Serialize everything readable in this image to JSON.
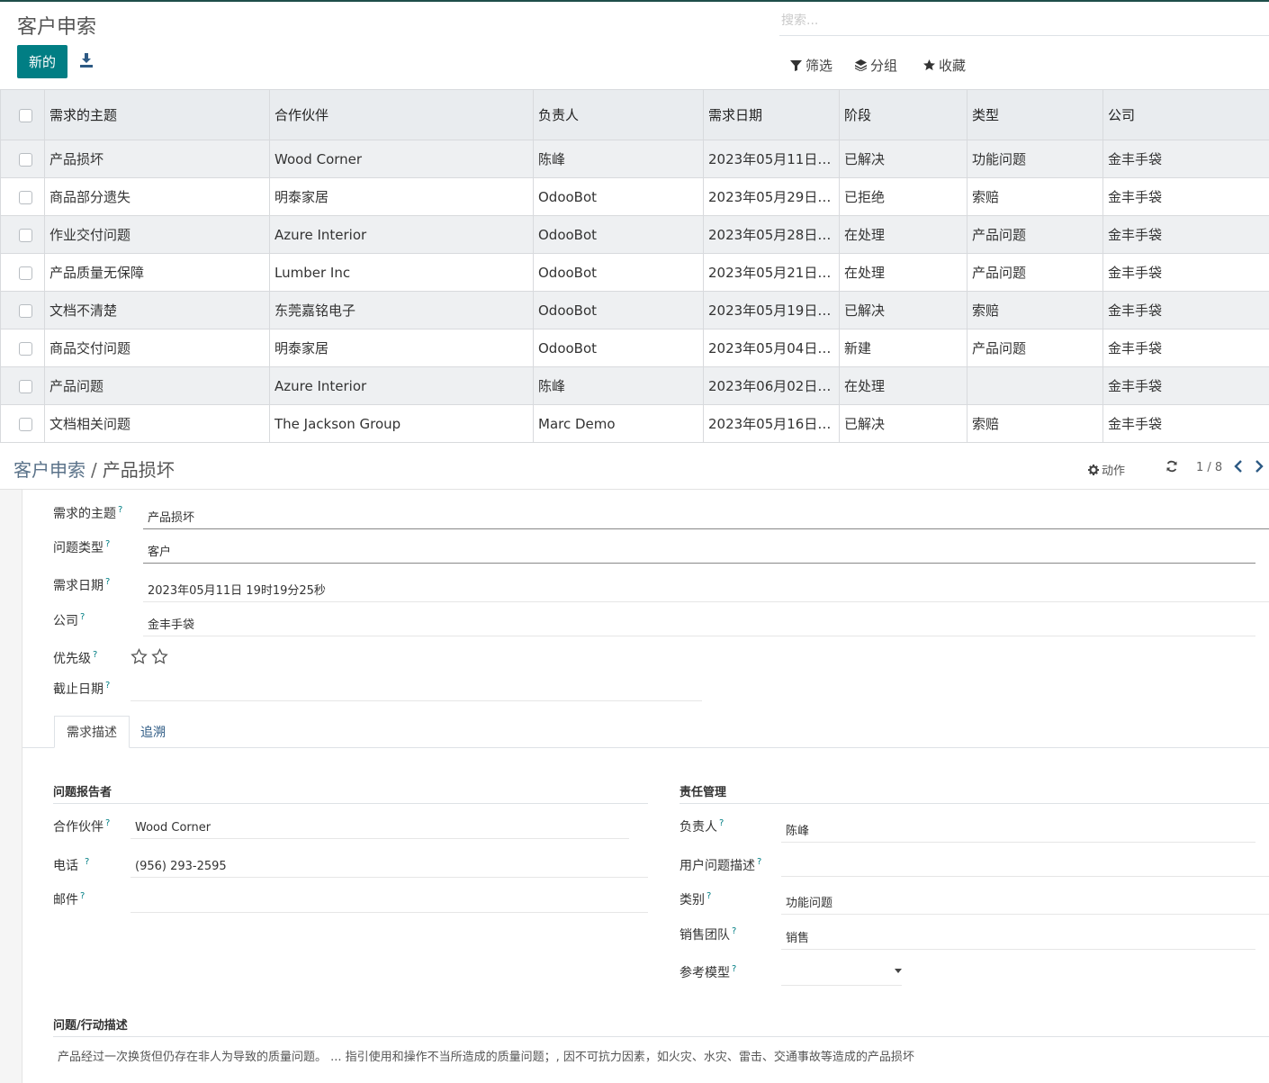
{
  "app": {
    "title": "客户申索",
    "new_label": "新的",
    "search_placeholder": "搜索...",
    "filter_label": "筛选",
    "group_label": "分组",
    "favorite_label": "收藏"
  },
  "table": {
    "columns": [
      "需求的主题",
      "合作伙伴",
      "负责人",
      "需求日期",
      "阶段",
      "类型",
      "公司"
    ],
    "rows": [
      [
        "产品损坏",
        "Wood Corner",
        "陈峰",
        "2023年05月11日 ...",
        "已解决",
        "功能问题",
        "金丰手袋"
      ],
      [
        "商品部分遗失",
        "明泰家居",
        "OdooBot",
        "2023年05月29日 ...",
        "已拒绝",
        "索赔",
        "金丰手袋"
      ],
      [
        "作业交付问题",
        "Azure Interior",
        "OdooBot",
        "2023年05月28日 ...",
        "在处理",
        "产品问题",
        "金丰手袋"
      ],
      [
        "产品质量无保障",
        "Lumber Inc",
        "OdooBot",
        "2023年05月21日 ...",
        "在处理",
        "产品问题",
        "金丰手袋"
      ],
      [
        "文档不清楚",
        "东莞嘉铭电子",
        "OdooBot",
        "2023年05月19日 ...",
        "已解决",
        "索赔",
        "金丰手袋"
      ],
      [
        "商品交付问题",
        "明泰家居",
        "OdooBot",
        "2023年05月04日 ...",
        "新建",
        "产品问题",
        "金丰手袋"
      ],
      [
        "产品问题",
        "Azure Interior",
        "陈峰",
        "2023年06月02日 ...",
        "在处理",
        "",
        "金丰手袋"
      ],
      [
        "文档相关问题",
        "The Jackson Group",
        "Marc Demo",
        "2023年05月16日 ...",
        "已解决",
        "索赔",
        "金丰手袋"
      ]
    ]
  },
  "form": {
    "breadcrumb_root": "客户申索",
    "breadcrumb_sep": "/",
    "breadcrumb_current": "产品损坏",
    "action_label": "动作",
    "pager": "1 / 8",
    "help_mark": "?",
    "fields": {
      "subject_label": "需求的主题",
      "subject_value": "产品损坏",
      "issue_type_label": "问题类型",
      "issue_type_value": "客户",
      "date_label": "需求日期",
      "date_value": "2023年05月11日 19时19分25秒",
      "company_label": "公司",
      "company_value": "金丰手袋",
      "priority_label": "优先级",
      "deadline_label": "截止日期"
    },
    "tabs": [
      "需求描述",
      "追溯"
    ],
    "reporter": {
      "title": "问题报告者",
      "partner_label": "合作伙伴",
      "partner_value": "Wood Corner",
      "phone_label": "电话",
      "phone_value": "(956) 293-2595",
      "email_label": "邮件"
    },
    "responsibility": {
      "title": "责任管理",
      "owner_label": "负责人",
      "owner_value": "陈峰",
      "user_desc_label": "用户问题描述",
      "category_label": "类别",
      "category_value": "功能问题",
      "team_label": "销售团队",
      "team_value": "销售",
      "ref_model_label": "参考模型"
    },
    "action_desc": {
      "title": "问题/行动描述",
      "text": "产品经过一次换货但仍存在非人为导致的质量问题。 ... 指引使用和操作不当所造成的质量问题；, 因不可抗力因素，如火灾、水灾、雷击、交通事故等造成的产品损坏"
    }
  },
  "colors": {
    "primary": "#017e84",
    "link": "#2d5a84",
    "header_bg": "#e9ecef"
  }
}
